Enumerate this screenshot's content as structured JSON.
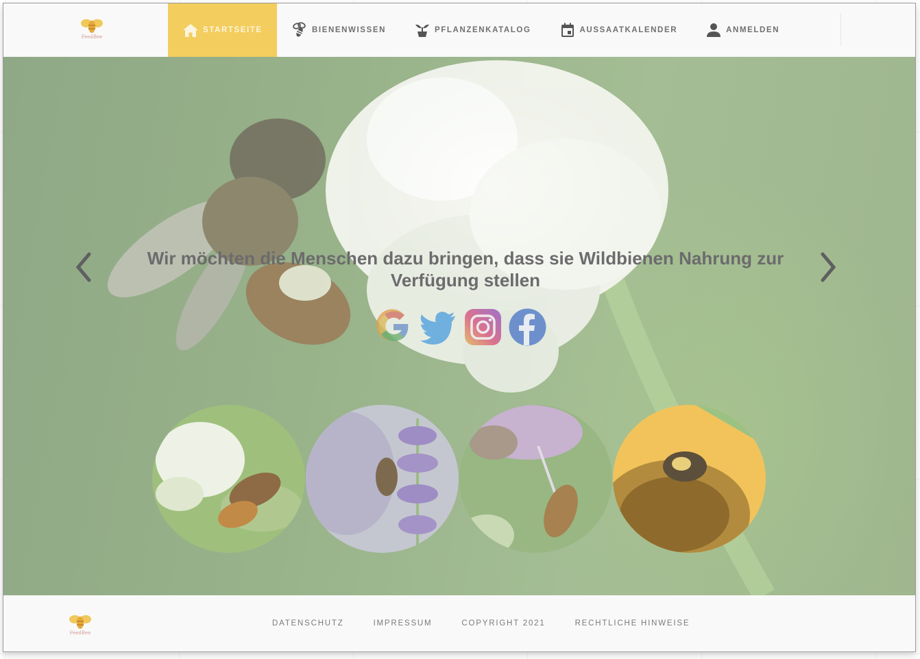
{
  "site": {
    "logo_icon": "bee-logo",
    "logo_text": "FeedBee",
    "accent_color": "#f3cd5d"
  },
  "nav": {
    "items": [
      {
        "label": "STARTSEITE",
        "icon": "home-icon",
        "active": true
      },
      {
        "label": "BIENENWISSEN",
        "icon": "bee-icon",
        "active": false
      },
      {
        "label": "PFLANZENKATALOG",
        "icon": "plant-icon",
        "active": false
      },
      {
        "label": "AUSSAATKALENDER",
        "icon": "calendar-icon",
        "active": false
      },
      {
        "label": "ANMELDEN",
        "icon": "person-icon",
        "active": false
      }
    ]
  },
  "hero": {
    "headline": "Wir möchten die Menschen dazu bringen, dass sie Wildbienen Nahrung zur Verfügung stellen",
    "prev_icon": "chevron-left-icon",
    "next_icon": "chevron-right-icon",
    "social": [
      "google-icon",
      "twitter-icon",
      "instagram-icon",
      "facebook-icon"
    ],
    "thumbnails": [
      "bee-on-clover",
      "bee-on-lavender",
      "bee-on-pink-flower",
      "bumblebee-on-sunflower"
    ]
  },
  "footer": {
    "links": [
      "DATENSCHUTZ",
      "IMPRESSUM",
      "COPYRIGHT 2021",
      "RECHTLICHE HINWEISE"
    ]
  }
}
